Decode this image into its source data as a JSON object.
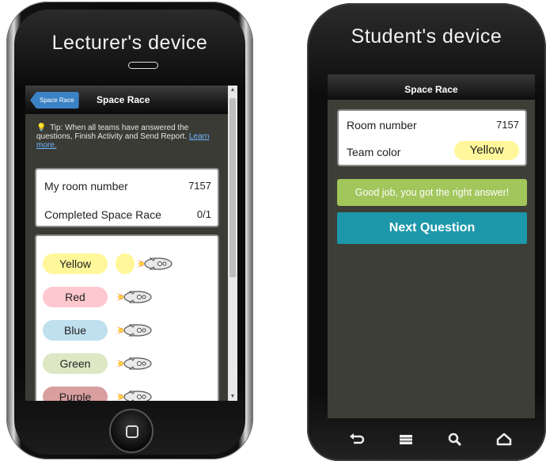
{
  "lecturer": {
    "heading": "Lecturer's device",
    "back_label": "Space Race",
    "bar_title": "Space Race",
    "tip": {
      "text": "Tip: When all teams have answered the questions, Finish Activity and Send Report.",
      "link": "Learn more."
    },
    "room": {
      "label": "My room number",
      "value": "7157"
    },
    "completed": {
      "label": "Completed Space Race",
      "value": "0/1"
    },
    "teams": [
      {
        "name": "Yellow",
        "color": "#fff79a"
      },
      {
        "name": "Red",
        "color": "#ffc8cf"
      },
      {
        "name": "Blue",
        "color": "#bfe0ee"
      },
      {
        "name": "Green",
        "color": "#dde7c4"
      },
      {
        "name": "Purple",
        "color": "#d99e9e"
      }
    ]
  },
  "student": {
    "heading": "Student's device",
    "bar_title": "Space Race",
    "room": {
      "label": "Room number",
      "value": "7157"
    },
    "team": {
      "label": "Team color",
      "value": "Yellow"
    },
    "message": "Good job, you got the right answer!",
    "next_button": "Next Question",
    "nav_icons": [
      "back-icon",
      "menu-icon",
      "search-icon",
      "home-icon"
    ]
  },
  "colors": {
    "accent_teal": "#1d97aa",
    "success_green": "#a2c65c",
    "back_blue": "#3b82c4",
    "screen_bg": "#3d3e36"
  }
}
